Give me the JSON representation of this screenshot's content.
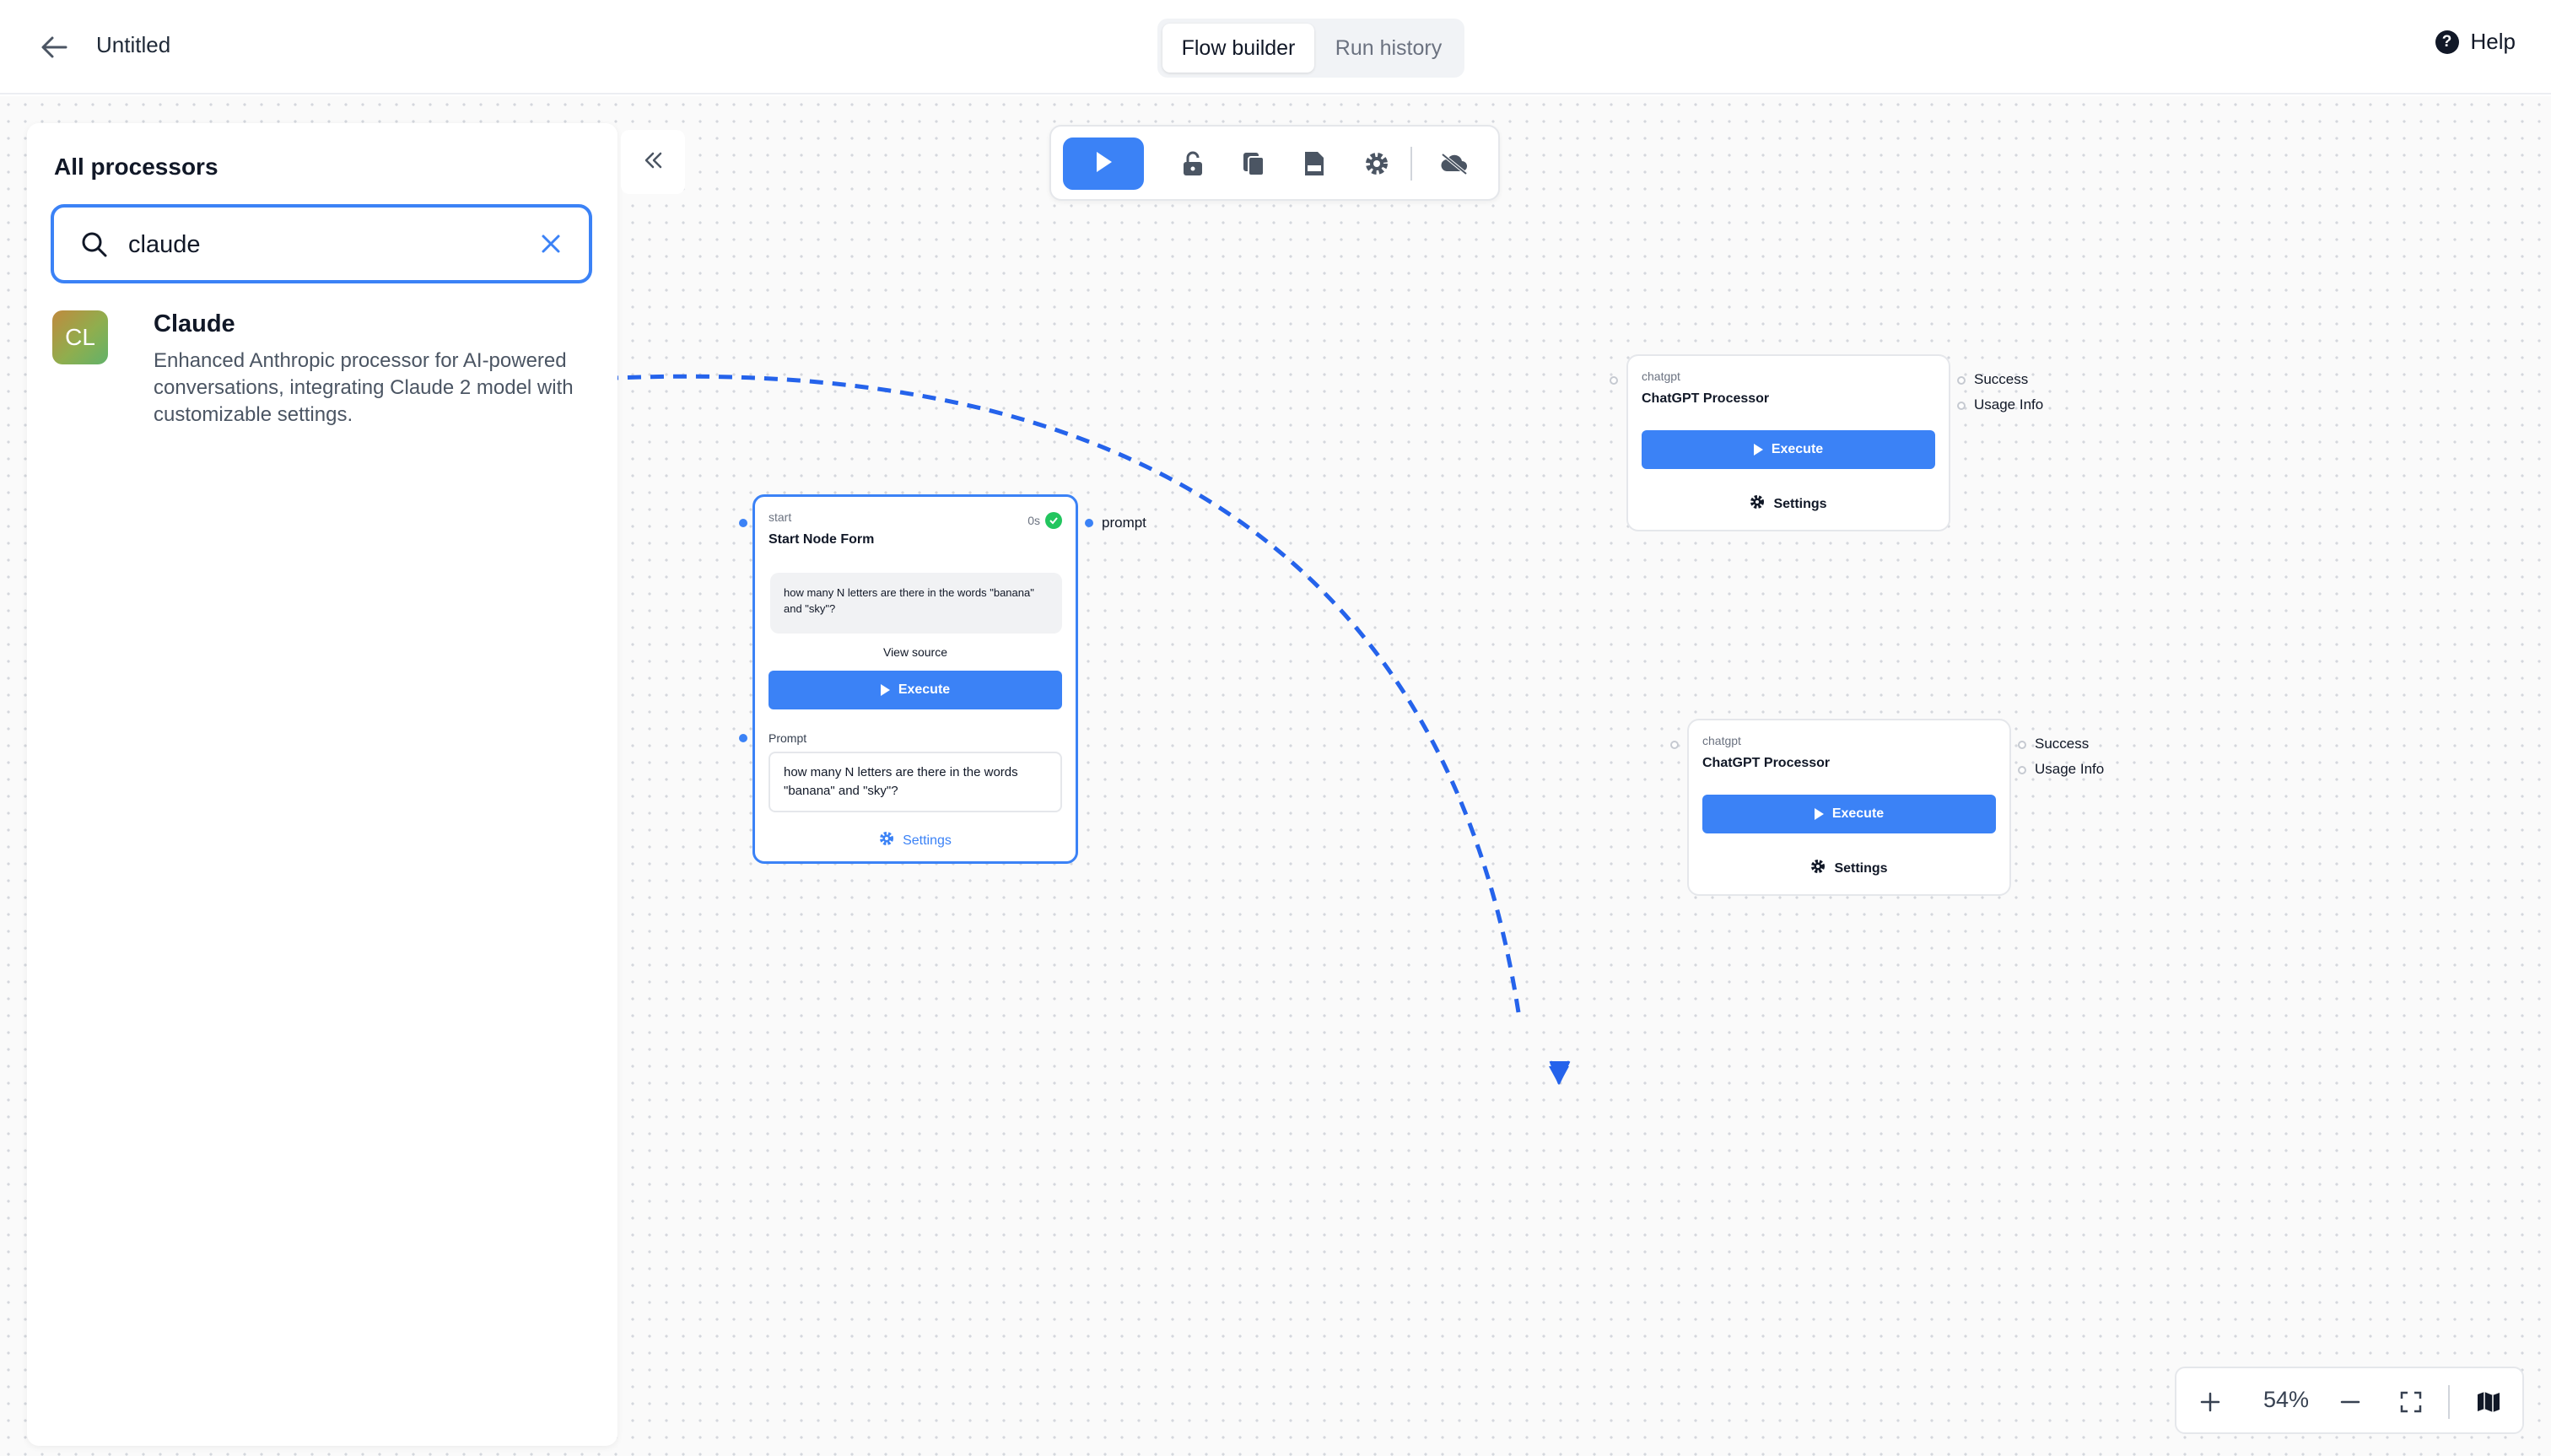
{
  "header": {
    "title": "Untitled",
    "tabs": [
      {
        "label": "Flow builder",
        "active": true
      },
      {
        "label": "Run history",
        "active": false
      }
    ],
    "help_label": "Help"
  },
  "panel": {
    "title": "All processors",
    "search": {
      "value": "claude",
      "placeholder": ""
    },
    "results": [
      {
        "initials": "CL",
        "name": "Claude",
        "description": "Enhanced Anthropic processor for AI-powered conversations, integrating Claude 2 model with customizable settings."
      }
    ]
  },
  "toolbar": {
    "icons": [
      "play-icon",
      "unlock-icon",
      "copy-icon",
      "log-file-icon",
      "gear-icon",
      "cloud-off-icon"
    ]
  },
  "nodes": {
    "start": {
      "type": "start",
      "name": "Start Node Form",
      "status_time": "0s",
      "message": "how many N letters are there in the words \"banana\" and \"sky\"?",
      "view_source": "View source",
      "execute_label": "Execute",
      "field_label": "Prompt",
      "prompt_value": "how many N letters are there in the words \"banana\" and \"sky\"?",
      "settings_label": "Settings",
      "output_label": "prompt"
    },
    "chatgpt_1": {
      "type": "chatgpt",
      "name": "ChatGPT Processor",
      "execute_label": "Execute",
      "settings_label": "Settings",
      "outputs": [
        "Success",
        "Usage Info"
      ]
    },
    "chatgpt_2": {
      "type": "chatgpt",
      "name": "ChatGPT Processor",
      "execute_label": "Execute",
      "settings_label": "Settings",
      "outputs": [
        "Success",
        "Usage Info"
      ]
    }
  },
  "zoom": {
    "level": "54%"
  },
  "colors": {
    "accent": "#3b82f6",
    "success": "#22c55e",
    "canvas_bg": "#fafafa",
    "connector": "#2563eb"
  }
}
